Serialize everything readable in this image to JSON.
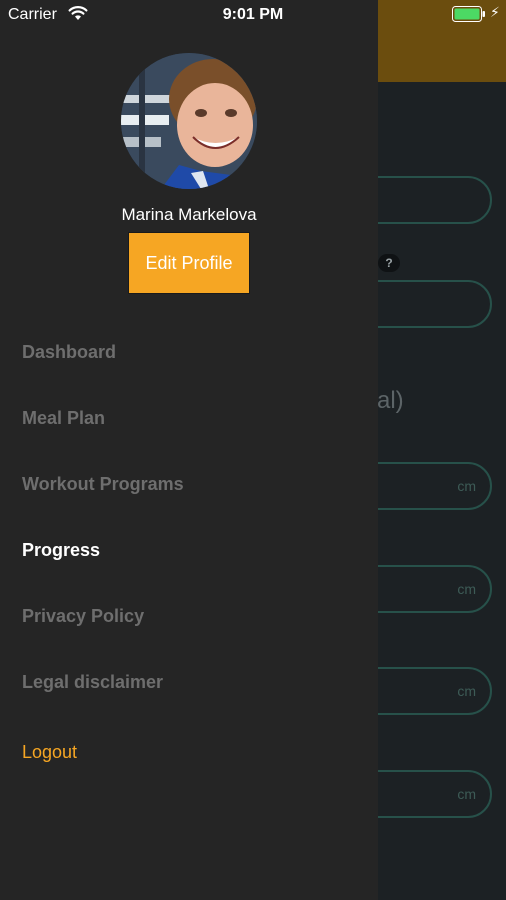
{
  "status_bar": {
    "carrier": "Carrier",
    "time": "9:01 PM"
  },
  "drawer": {
    "user_name": "Marina Markelova",
    "edit_profile_label": "Edit Profile",
    "menu": [
      {
        "label": "Dashboard",
        "state": "inactive"
      },
      {
        "label": "Meal Plan",
        "state": "inactive"
      },
      {
        "label": "Workout Programs",
        "state": "inactive"
      },
      {
        "label": "Progress",
        "state": "active"
      },
      {
        "label": "Privacy Policy",
        "state": "inactive"
      },
      {
        "label": "Legal disclaimer",
        "state": "inactive"
      },
      {
        "label": "Logout",
        "state": "logout"
      }
    ]
  },
  "background": {
    "help_badge": "?",
    "partial_heading": "al)",
    "units": [
      "cm",
      "cm",
      "cm",
      "cm"
    ]
  },
  "colors": {
    "drawer_bg": "#252525",
    "accent": "#f6a623",
    "header_bg": "#6b4d0e",
    "menu_inactive": "#6e6e6e",
    "menu_active": "#ffffff",
    "field_border": "#27514a"
  },
  "icons": [
    "wifi-icon",
    "battery-icon",
    "charging-bolt-icon",
    "help-icon"
  ]
}
